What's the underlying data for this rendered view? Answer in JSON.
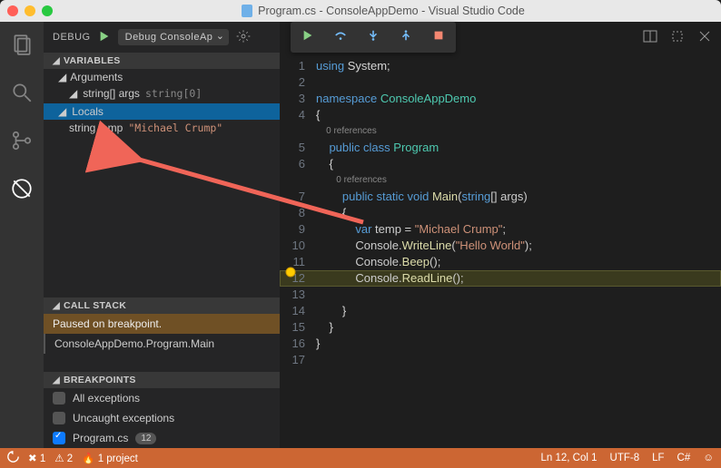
{
  "title": "Program.cs - ConsoleAppDemo - Visual Studio Code",
  "debug": {
    "header": "DEBUG",
    "config": "Debug ConsoleAp",
    "variables_label": "VARIABLES",
    "arguments_label": "Arguments",
    "args_name": "string[] args",
    "args_val": "string[0]",
    "locals_label": "Locals",
    "local_name": "string temp",
    "local_val": "\"Michael Crump\"",
    "callstack_label": "CALL STACK",
    "callstack_status": "Paused on breakpoint.",
    "callstack_frame": "ConsoleAppDemo.Program.Main",
    "breakpoints_label": "BREAKPOINTS",
    "bp_all": "All exceptions",
    "bp_uncaught": "Uncaught exceptions",
    "bp_file": "Program.cs",
    "bp_file_line": "12"
  },
  "code": {
    "l1": "using System;",
    "l3": "namespace ConsoleAppDemo",
    "l4": "{",
    "ref0": "0 references",
    "l5": "    public class Program",
    "l6": "    {",
    "ref1": "0 references",
    "l7": "        public static void Main(string[] args)",
    "l8": "        {",
    "l9": "            var temp = \"Michael Crump\";",
    "l10": "            Console.WriteLine(\"Hello World\");",
    "l11": "            Console.Beep();",
    "l12": "            Console.ReadLine();",
    "l13": "",
    "l14": "        }",
    "l15": "    }",
    "l16": "}",
    "l17": ""
  },
  "status": {
    "errors": "1",
    "warnings": "2",
    "projects": "1 project",
    "cursor": "Ln 12, Col 1",
    "encoding": "UTF-8",
    "eol": "LF",
    "lang": "C#"
  }
}
